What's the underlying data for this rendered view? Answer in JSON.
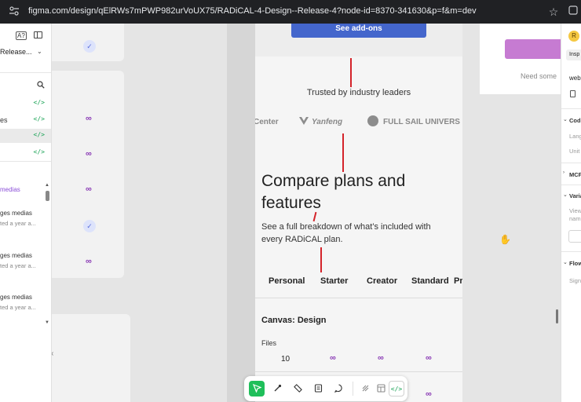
{
  "browser": {
    "url": "figma.com/design/qElRWs7mPWP982urVoUX75/RADiCAL-4-Design--Release-4?node-id=8370-341630&p=f&m=dev"
  },
  "left_panel": {
    "file_name": "Release...",
    "rows": [
      "es"
    ],
    "media_link": "medias",
    "media_items": [
      {
        "title": "ges medias",
        "sub": "ted a year a..."
      },
      {
        "title": "ges medias",
        "sub": "ted a year a..."
      },
      {
        "title": "ges medias",
        "sub": "ted a year a..."
      }
    ]
  },
  "frame": {
    "addons_button": "See add-ons",
    "trusted_heading": "Trusted by industry leaders",
    "logos": [
      "Center",
      "Yanfeng",
      "FULL SAIL UNIVERS"
    ],
    "compare_title_line1": "Compare plans and",
    "compare_title_line2": "features",
    "compare_subtitle_line1": "See a full breakdown of what’s included with",
    "compare_subtitle_line2": "every RADiCAL plan.",
    "plans": [
      "Personal",
      "Starter",
      "Creator",
      "Standard",
      "Pr"
    ],
    "section_title": "Canvas: Design",
    "files_label": "Files",
    "files_personal_value": "10",
    "infinity": "∞"
  },
  "right_canvas": {
    "need_some": "Need some"
  },
  "inspector": {
    "avatar_initial": "R",
    "tab_label": "Insp",
    "item_web": "web",
    "section_code": "Cod",
    "lang_label": "Lang",
    "unit_label": "Unit",
    "section_mcp": "MCP",
    "section_variables": "Varia",
    "view_label": "View",
    "name_label": "nam",
    "section_flow": "Flow",
    "signal_label": "Signa"
  },
  "colors": {
    "accent_blue": "#4466cc",
    "infinity_purple": "#8a3ab5",
    "code_green": "#1aa356",
    "red_annotation": "#d4232a",
    "active_tool_green": "#1fbf5a"
  }
}
